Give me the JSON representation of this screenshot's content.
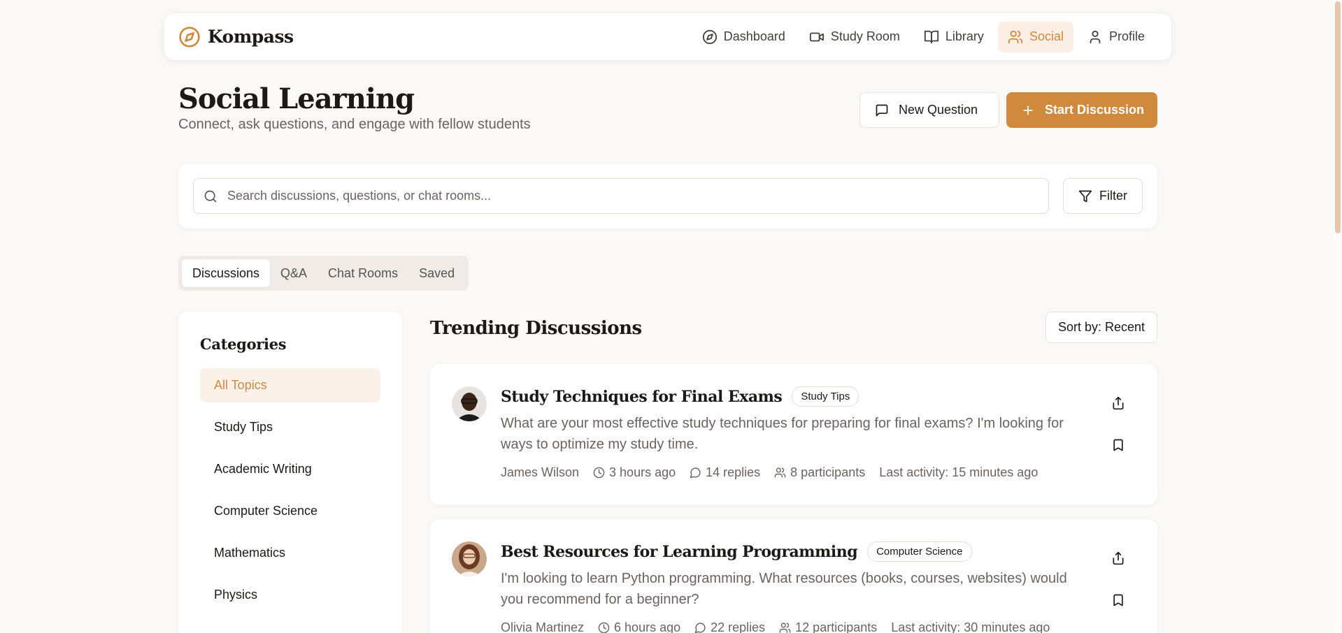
{
  "colors": {
    "accent": "#d08a3e",
    "accent_soft": "#fbeee4",
    "background": "#faf9f7",
    "muted_text": "#6b6360"
  },
  "brand": {
    "name": "Kompass",
    "icon": "compass-icon"
  },
  "nav": {
    "items": [
      {
        "label": "Dashboard",
        "icon": "compass-icon"
      },
      {
        "label": "Study Room",
        "icon": "video-icon"
      },
      {
        "label": "Library",
        "icon": "book-open-icon"
      },
      {
        "label": "Social",
        "icon": "users-icon",
        "active": true
      },
      {
        "label": "Profile",
        "icon": "user-icon"
      }
    ]
  },
  "header": {
    "title": "Social Learning",
    "subtitle": "Connect, ask questions, and engage with fellow students",
    "new_question_label": "New Question",
    "start_discussion_label": "Start Discussion"
  },
  "search": {
    "placeholder": "Search discussions, questions, or chat rooms...",
    "value": "",
    "filter_label": "Filter"
  },
  "tabs": [
    {
      "label": "Discussions",
      "active": true
    },
    {
      "label": "Q&A"
    },
    {
      "label": "Chat Rooms"
    },
    {
      "label": "Saved"
    }
  ],
  "sidebar": {
    "title": "Categories",
    "items": [
      {
        "label": "All Topics",
        "active": true
      },
      {
        "label": "Study Tips"
      },
      {
        "label": "Academic Writing"
      },
      {
        "label": "Computer Science"
      },
      {
        "label": "Mathematics"
      },
      {
        "label": "Physics"
      }
    ]
  },
  "main": {
    "section_title": "Trending Discussions",
    "sort_label": "Sort by: Recent",
    "posts": [
      {
        "title": "Study Techniques for Final Exams",
        "tag": "Study Tips",
        "body": "What are your most effective study techniques for preparing for final exams? I'm looking for ways to optimize my study time.",
        "author": "James Wilson",
        "time": "3 hours ago",
        "replies": "14 replies",
        "participants": "8 participants",
        "last_activity": "Last activity: 15 minutes ago"
      },
      {
        "title": "Best Resources for Learning Programming",
        "tag": "Computer Science",
        "body": "I'm looking to learn Python programming. What resources (books, courses, websites) would you recommend for a beginner?",
        "author": "Olivia Martinez",
        "time": "6 hours ago",
        "replies": "22 replies",
        "participants": "12 participants",
        "last_activity": "Last activity: 30 minutes ago"
      }
    ]
  }
}
